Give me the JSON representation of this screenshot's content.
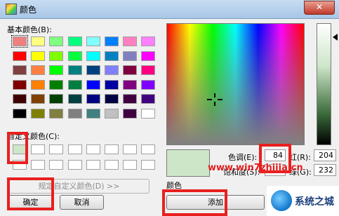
{
  "window": {
    "title": "颜色",
    "close_glyph": "✕"
  },
  "labels": {
    "basic_colors": "基本颜色(B):",
    "custom_colors": "自定义颜色(C):",
    "color_solid": "颜色"
  },
  "basic_colors": [
    "#f08080",
    "#ffff80",
    "#80ff80",
    "#00ff80",
    "#80ffff",
    "#0080ff",
    "#ff80c0",
    "#ff80ff",
    "#ff0000",
    "#ffff00",
    "#80ff00",
    "#00ff40",
    "#00ffff",
    "#0080c0",
    "#8080c0",
    "#ff00ff",
    "#804040",
    "#ff8040",
    "#00ff00",
    "#008080",
    "#004080",
    "#8080ff",
    "#800040",
    "#ff0080",
    "#800000",
    "#ff8000",
    "#008000",
    "#008040",
    "#0000ff",
    "#0000a0",
    "#800080",
    "#8000ff",
    "#400000",
    "#804000",
    "#004000",
    "#004040",
    "#000080",
    "#000040",
    "#400040",
    "#400080",
    "#000000",
    "#808000",
    "#808040",
    "#808080",
    "#408080",
    "#c0c0c0",
    "#400040",
    "#ffffff"
  ],
  "custom_colors": [
    "#cde6c8",
    "#ffffff",
    "#ffffff",
    "#ffffff",
    "#ffffff",
    "#ffffff",
    "#ffffff",
    "#ffffff",
    "#ffffff",
    "#ffffff",
    "#ffffff",
    "#ffffff",
    "#ffffff",
    "#ffffff",
    "#ffffff",
    "#ffffff"
  ],
  "fields": {
    "hue": {
      "label": "色调(E):",
      "value": "84"
    },
    "sat": {
      "label": "饱和度(S):",
      "value": ""
    },
    "red": {
      "label": "红(R):",
      "value": "204"
    },
    "green": {
      "label": "绿(G):",
      "value": "232"
    }
  },
  "buttons": {
    "define_custom": "规定自定义颜色(D) >>",
    "ok": "确定",
    "cancel": "取消",
    "add_custom": "添加"
  },
  "watermark": "www.win7zhijia.cn",
  "logo_text": "系统之城",
  "accent_highlight": "#e8201f",
  "selected_color": "#cde6c8"
}
